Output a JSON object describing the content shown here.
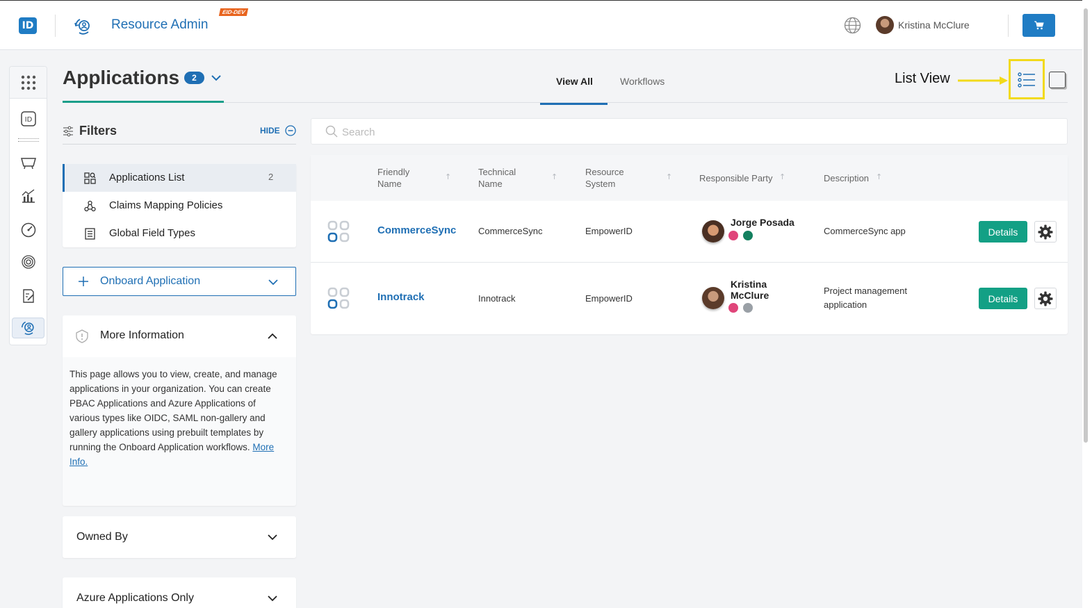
{
  "header": {
    "logo_text": "ID",
    "app_title": "Resource Admin",
    "env_badge": "EID-DEV",
    "user_name": "Kristina McClure",
    "accent": "#1f7cc4"
  },
  "page": {
    "title": "Applications",
    "count": "2",
    "tabs": [
      {
        "label": "View All",
        "active": true
      },
      {
        "label": "Workflows",
        "active": false
      }
    ],
    "annotation": "List View"
  },
  "filters": {
    "title": "Filters",
    "hide_label": "HIDE",
    "items": [
      {
        "label": "Applications List",
        "count": "2",
        "icon": "applications-list-icon",
        "active": true
      },
      {
        "label": "Claims Mapping Policies",
        "count": "",
        "icon": "claims-mapping-icon",
        "active": false
      },
      {
        "label": "Global Field Types",
        "count": "",
        "icon": "global-field-types-icon",
        "active": false
      }
    ]
  },
  "onboard": {
    "label": "Onboard Application"
  },
  "more_info": {
    "title": "More Information",
    "text": "This page allows you to view, create, and manage applications in your organization. You can create PBAC Applications and Azure Applications of various types like OIDC, SAML non-gallery and gallery applications using prebuilt templates by running the Onboard Application workflows.",
    "link": "More Info."
  },
  "collapsibles": [
    {
      "label": "Owned By"
    },
    {
      "label": "Azure Applications Only"
    }
  ],
  "search": {
    "placeholder": "Search",
    "value": ""
  },
  "table": {
    "columns": [
      {
        "label": "Friendly\nName"
      },
      {
        "label": "Technical\nName"
      },
      {
        "label": "Resource\nSystem"
      },
      {
        "label": "Responsible Party"
      },
      {
        "label": "Description"
      }
    ],
    "rows": [
      {
        "friendly_name": "CommerceSync",
        "technical_name": "CommerceSync",
        "resource_system": "EmpowerID",
        "responsible_party": "Jorge Posada",
        "description": "CommerceSync app",
        "details_label": "Details"
      },
      {
        "friendly_name": "Innotrack",
        "technical_name": "Innotrack",
        "resource_system": "EmpowerID",
        "responsible_party": "Kristina\nMcClure",
        "description": "Project management\napplication",
        "details_label": "Details"
      }
    ]
  },
  "colors": {
    "primary": "#1f6fb4",
    "success": "#13a085",
    "highlight": "#f2da1b",
    "env_badge": "#e8641e"
  }
}
